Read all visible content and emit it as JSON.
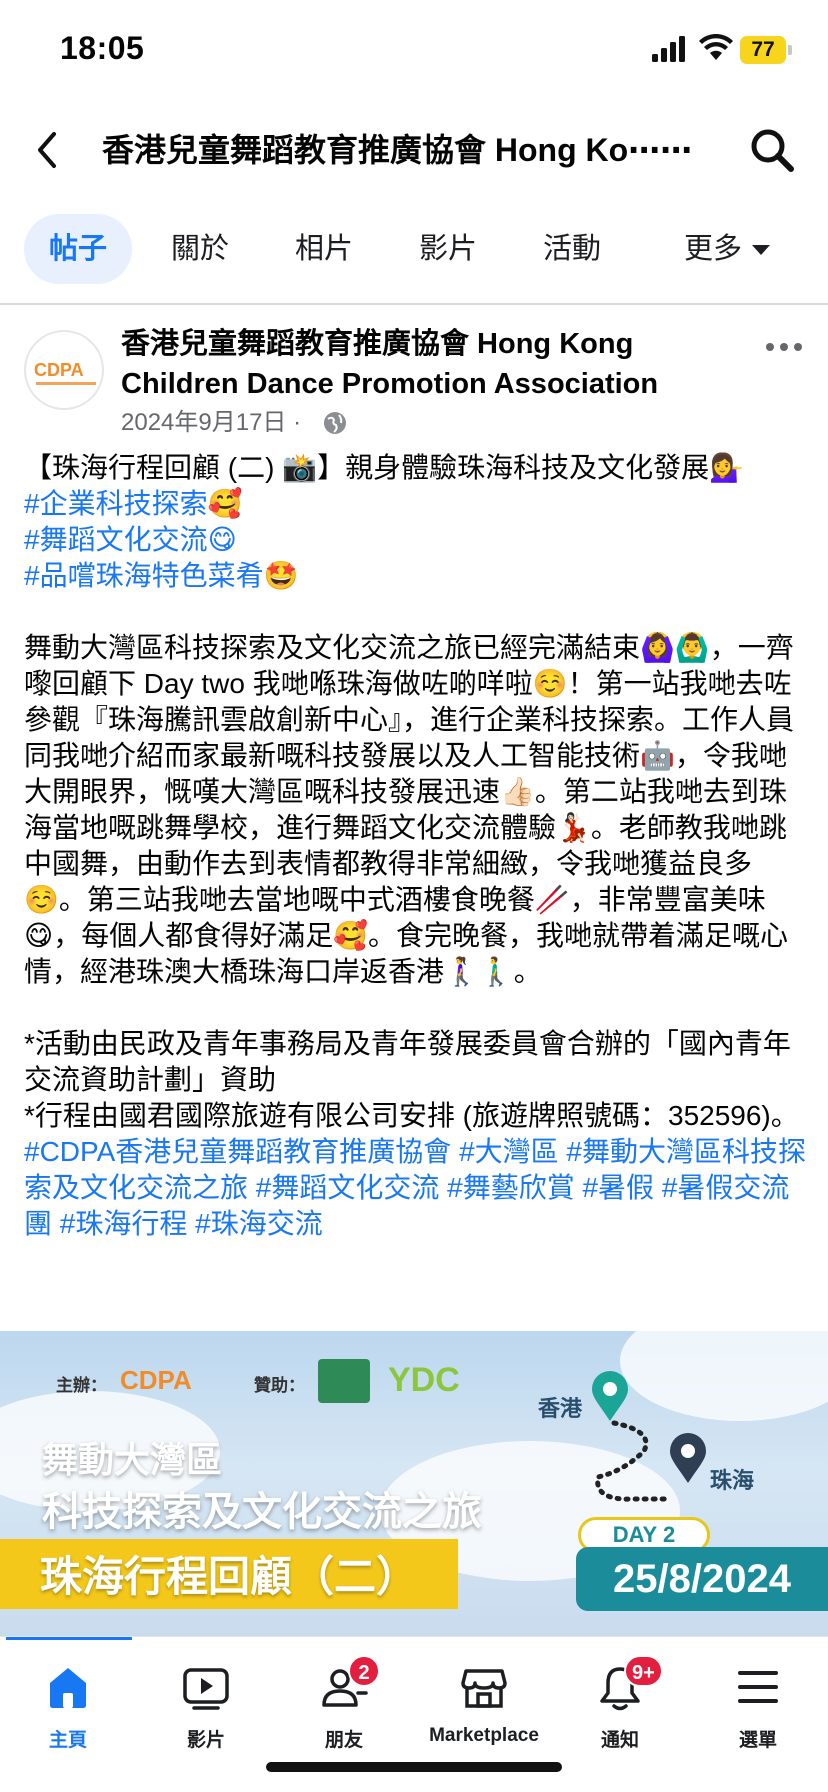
{
  "status_bar": {
    "time": "18:05",
    "battery": "77"
  },
  "top_nav": {
    "title": "香港兒童舞蹈教育推廣協會 Hong Ko⋯⋯"
  },
  "tabs": [
    {
      "label": "帖子",
      "active": true
    },
    {
      "label": "關於",
      "active": false
    },
    {
      "label": "相片",
      "active": false
    },
    {
      "label": "影片",
      "active": false
    },
    {
      "label": "活動",
      "active": false
    },
    {
      "label": "更多",
      "active": false
    }
  ],
  "post": {
    "avatar_text": "CDPA",
    "author": "香港兒童舞蹈教育推廣協會 Hong Kong Children Dance Promotion Association",
    "date": "2024年9月17日 ·",
    "title": "【珠海行程回顧 (二) 📸】親身體驗珠海科技及文化發展💁‍♀️",
    "hashtag_lines": [
      "#企業科技探索🥰",
      "#舞蹈文化交流😋",
      "#品嚐珠海特色菜肴🤩"
    ],
    "paragraph1": "舞動大灣區科技探索及文化交流之旅已經完滿結束🙆‍♀️🙆‍♂️，一齊嚟回顧下 Day two 我哋喺珠海做咗啲咩啦☺️！第一站我哋去咗參觀『珠海騰訊雲啟創新中心』，進行企業科技探索。工作人員同我哋介紹而家最新嘅科技發展以及人工智能技術🤖，令我哋大開眼界，慨嘆大灣區嘅科技發展迅速👍🏻。第二站我哋去到珠海當地嘅跳舞學校，進行舞蹈文化交流體驗💃🏻。老師教我哋跳中國舞，由動作去到表情都教得非常細緻，令我哋獲益良多☺️。第三站我哋去當地嘅中式酒樓食晚餐🥢，非常豐富美味😋，每個人都食得好滿足🥰。食完晚餐，我哋就帶着滿足嘅心情，經港珠澳大橋珠海口岸返香港🚶‍♀️🚶‍♂️。",
    "note1": "*活動由民政及青年事務局及青年發展委員會合辦的「國內青年交流資助計劃」資助",
    "note2": "*行程由國君國際旅遊有限公司安排 (旅遊牌照號碼：352596)。",
    "footer_hashtags": "#CDPA香港兒童舞蹈教育推廣協會 #大灣區 #舞動大灣區科技探索及文化交流之旅 #舞蹈文化交流 #舞藝欣賞 #暑假 #暑假交流團 #珠海行程 #珠海交流"
  },
  "banner": {
    "organizer_label": "主辦：",
    "sponsor_label": "贊助：",
    "organizer_logo": "CDPA",
    "sponsor_logo": "YDC",
    "title_line1": "舞動大灣區",
    "title_line2": "科技探索及文化交流之旅",
    "title_line3": "珠海行程回顧（二）",
    "route_from": "香港",
    "route_to": "珠海",
    "day_label": "DAY 2",
    "date": "25/8/2024"
  },
  "bottom_bar": [
    {
      "label": "主頁",
      "icon": "home-icon",
      "active": true,
      "badge": ""
    },
    {
      "label": "影片",
      "icon": "video-icon",
      "active": false,
      "badge": ""
    },
    {
      "label": "朋友",
      "icon": "friends-icon",
      "active": false,
      "badge": "2"
    },
    {
      "label": "Marketplace",
      "icon": "marketplace-icon",
      "active": false,
      "badge": ""
    },
    {
      "label": "通知",
      "icon": "bell-icon",
      "active": false,
      "badge": "9+"
    },
    {
      "label": "選單",
      "icon": "menu-icon",
      "active": false,
      "badge": ""
    }
  ],
  "colors": {
    "accent": "#1877f2",
    "badge": "#e41e3f",
    "battery": "#f7d51d",
    "banner_teal": "#1a8c9a",
    "banner_yellow": "#f3c81a"
  }
}
